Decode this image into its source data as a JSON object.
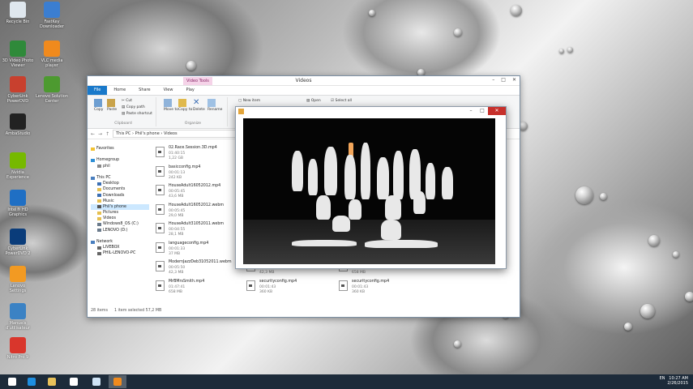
{
  "desktop": {
    "icons": [
      {
        "label": "Recycle Bin",
        "color": "#dfe7ee"
      },
      {
        "label": "FastKey Downloader",
        "color": "#3b7ed1"
      },
      {
        "label": "3D Video Photo Viewer",
        "color": "#2f8a3a"
      },
      {
        "label": "VLC media player",
        "color": "#f08a1d"
      },
      {
        "label": "CyberLink PowerDVD",
        "color": "#c8402e"
      },
      {
        "label": "Lenovo Solution Center",
        "color": "#4d9a30"
      },
      {
        "label": "AmbaStudio",
        "color": "#222222"
      },
      {
        "label": "Nvidia Experience",
        "color": "#76b900"
      },
      {
        "label": "Intel® HD Graphics",
        "color": "#1f6fc4"
      },
      {
        "label": "CyberLink PowerDVD 2",
        "color": "#0a3c7a"
      },
      {
        "label": "Lenovo Settings",
        "color": "#f29a22"
      },
      {
        "label": "Manuels d'utilisateur",
        "color": "#3b82c4"
      },
      {
        "label": "Nitro Pro 9",
        "color": "#d9362c"
      }
    ]
  },
  "explorer": {
    "title": "Videos",
    "context_tab": "Video Tools",
    "tabs": [
      "File",
      "Home",
      "Share",
      "View",
      "Play"
    ],
    "ribbon": {
      "clipboard": {
        "label": "Clipboard",
        "copy": "Copy",
        "paste": "Paste",
        "cut": "Cut",
        "copy_path": "Copy path",
        "paste_shortcut": "Paste shortcut"
      },
      "organize": {
        "label": "Organize",
        "move_to": "Move to",
        "copy_to": "Copy to",
        "delete": "Delete",
        "rename": "Rename"
      },
      "new_item": "New item",
      "open": "Open",
      "select_all": "Select all"
    },
    "path": [
      "This PC",
      "Phil's phone",
      "Videos"
    ],
    "nav": [
      {
        "label": "Favorites",
        "indent": 0,
        "color": "#f2c233"
      },
      {
        "label": "",
        "indent": 0,
        "color": ""
      },
      {
        "label": "Homegroup",
        "indent": 0,
        "color": "#2d8fd5"
      },
      {
        "label": "phil",
        "indent": 1,
        "color": "#888888"
      },
      {
        "label": "",
        "indent": 0,
        "color": ""
      },
      {
        "label": "This PC",
        "indent": 0,
        "color": "#4a7fbf"
      },
      {
        "label": "Desktop",
        "indent": 1,
        "color": "#3c6fb3"
      },
      {
        "label": "Documents",
        "indent": 1,
        "color": "#e6c050"
      },
      {
        "label": "Downloads",
        "indent": 1,
        "color": "#3c6fb3"
      },
      {
        "label": "Music",
        "indent": 1,
        "color": "#e6c050"
      },
      {
        "label": "Phil's phone",
        "indent": 1,
        "color": "#555555",
        "selected": true
      },
      {
        "label": "Pictures",
        "indent": 1,
        "color": "#e6c050"
      },
      {
        "label": "Videos",
        "indent": 1,
        "color": "#e6c050"
      },
      {
        "label": "Windows8_OS (C:)",
        "indent": 1,
        "color": "#6b7b8c"
      },
      {
        "label": "LENOVO (D:)",
        "indent": 1,
        "color": "#6b7b8c"
      },
      {
        "label": "",
        "indent": 0,
        "color": ""
      },
      {
        "label": "Network",
        "indent": 0,
        "color": "#4a7fbf"
      },
      {
        "label": "LIVEBOX",
        "indent": 1,
        "color": "#666666"
      },
      {
        "label": "PHIL-LENOVO-PC",
        "indent": 1,
        "color": "#666666"
      }
    ],
    "files": [
      {
        "name": "02.Race.Session.3D.mp4",
        "duration": "01:40:15",
        "size": "1,22 GB"
      },
      {
        "name": "basicconfig.mp4",
        "duration": "00:01:13",
        "size": "242 KB"
      },
      {
        "name": "HouseAdult16052012.mp4",
        "duration": "00:05:45",
        "size": "43,6 MB"
      },
      {
        "name": "HouseAdult16052012.webm",
        "duration": "00:05:45",
        "size": "29,0 MB"
      },
      {
        "name": "HouseAdult31052011.webm",
        "duration": "00:04:55",
        "size": "28,1 MB"
      },
      {
        "name": "languageconfig.mp4",
        "duration": "00:01:33",
        "size": "37 MB"
      },
      {
        "name": "ModernJazzDeb31052011.webm",
        "duration": "00:05:50",
        "size": "42,3 MB"
      },
      {
        "name": "ModernJazzDeb31052011.webm",
        "duration": "00:05:50",
        "size": "42,3 MB"
      },
      {
        "name": "MrBMrsSmith.mp4",
        "duration": "01:47:41",
        "size": "658 MB"
      },
      {
        "name": "MrBMrsSmith.mp4",
        "duration": "01:47:41",
        "size": "658 MB"
      },
      {
        "name": "securityconfig.mp4",
        "duration": "00:01:43",
        "size": "360 KB"
      },
      {
        "name": "securityconfig.mp4",
        "duration": "00:01:43",
        "size": "360 KB"
      }
    ],
    "status": {
      "count": "28 items",
      "selection": "1 item selected 57,2 MB"
    }
  },
  "player": {
    "buttons": [
      "–",
      "□",
      "✕"
    ]
  },
  "taskbar": {
    "items": [
      {
        "icon": "start-icon",
        "color": "#ffffff"
      },
      {
        "icon": "internet-explorer-icon",
        "color": "#1e8ee0"
      },
      {
        "icon": "file-explorer-icon",
        "color": "#e8c15a"
      },
      {
        "icon": "home-icon",
        "color": "#ffffff"
      },
      {
        "icon": "display-icon",
        "color": "#cfe3f5"
      },
      {
        "icon": "media-player-icon",
        "color": "#f08a1d"
      }
    ],
    "tray_lang": "EN",
    "time": "10:27 AM",
    "date": "2/26/2015"
  }
}
